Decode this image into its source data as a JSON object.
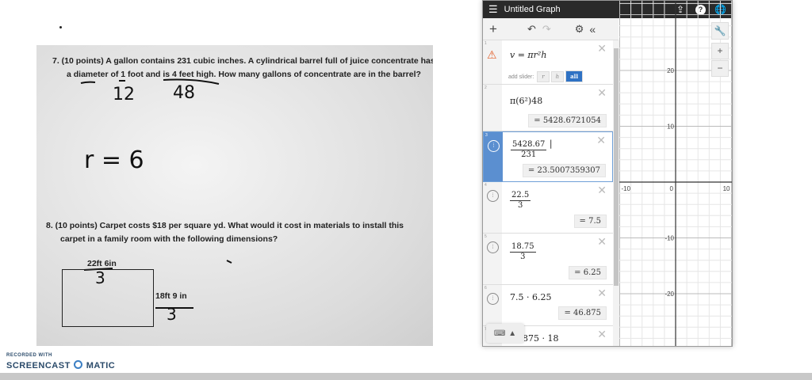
{
  "worksheet": {
    "q7_line1": "7.   (10 points) A gallon contains 231 cubic inches.  A cylindrical barrel full of juice concentrate has",
    "q7_line2": "a diameter of 1 foot and is 4 feet high.  How many gallons of concentrate are in the barrel?",
    "q8_line1": "8.   (10 points) Carpet costs $18 per square yd. What would it cost in materials to install this",
    "q8_line2": "carpet in a family room with the following dimensions?",
    "width_label": "22ft 6in",
    "height_label": "18ft 9 in",
    "handwriting": {
      "diameter": "12",
      "height": "48",
      "radius": "r = 6",
      "div_width": "3",
      "div_height": "3"
    }
  },
  "watermark": {
    "line1": "RECORDED WITH",
    "line2": "SCREENCAST",
    "line3": "MATIC"
  },
  "desmos": {
    "title": "Untitled Graph",
    "add_slider_label": "add slider:",
    "slider_buttons": [
      "r",
      "h",
      "all"
    ],
    "expressions": [
      {
        "num": "1",
        "latex": "v = πr²h",
        "warning": true
      },
      {
        "num": "2",
        "expr": "π(6²)48",
        "result": "= 5428.6721054"
      },
      {
        "num": "3",
        "numerator": "5428.67",
        "denominator": "231",
        "result": "= 23.5007359307"
      },
      {
        "num": "4",
        "numerator": "22.5",
        "denominator": "3",
        "result": "= 7.5"
      },
      {
        "num": "5",
        "numerator": "18.75",
        "denominator": "3",
        "result": "= 6.25"
      },
      {
        "num": "6",
        "expr": "7.5 · 6.25",
        "result": "= 46.875"
      },
      {
        "num": "7",
        "expr": "875 · 18"
      }
    ],
    "axis": {
      "x_ticks": [
        "-10",
        "0",
        "10"
      ],
      "y_ticks": [
        "20",
        "10",
        "-10",
        "-20"
      ]
    },
    "zoom_in": "+",
    "zoom_out": "−"
  }
}
